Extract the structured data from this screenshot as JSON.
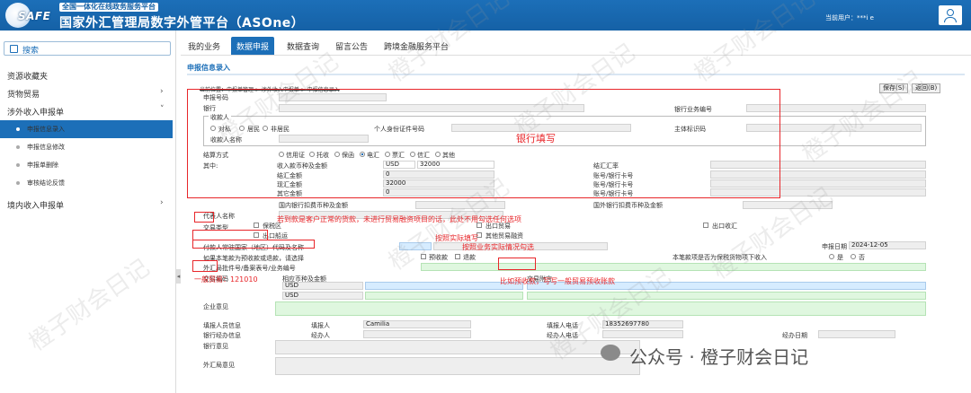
{
  "header": {
    "tagline": "全国一体化在线政务服务平台",
    "title": "国家外汇管理局数字外管平台（ASOne）",
    "logo_text": "SAFE",
    "current_user": "当前用户：***i e"
  },
  "sidebar": {
    "search_label": "搜索",
    "items": [
      {
        "label": "资源收藏夹"
      },
      {
        "label": "货物贸易"
      },
      {
        "label": "涉外收入申报单"
      },
      {
        "label": "境内收入申报单"
      }
    ],
    "sub_items": [
      {
        "label": "申报信息录入"
      },
      {
        "label": "申报信息修改"
      },
      {
        "label": "申报单删除"
      },
      {
        "label": "审核结论反馈"
      }
    ]
  },
  "tabs": [
    {
      "label": "我的业务"
    },
    {
      "label": "数据申报"
    },
    {
      "label": "数据查询"
    },
    {
      "label": "留言公告"
    },
    {
      "label": "跨境金融服务平台"
    }
  ],
  "form": {
    "title": "申报信息录入",
    "breadcrumb": "当前位置：申报单管理 > 涉外收入申报单 > 申报信息录入",
    "save_btn": "保存(S)",
    "back_btn": "返回(B)",
    "labels": {
      "report_no": "申报号码",
      "bank": "银行",
      "bank_business_no": "银行业务编号",
      "payee_group": "收款人",
      "corporate": "对私",
      "resident": "居民",
      "nonresident": "非居民",
      "personal_id": "个人身份证件号码",
      "payee_name": "收款人名称",
      "main_ref": "主体标识码",
      "settle_method": "结算方式",
      "m_credit": "信用证",
      "m_collect": "托收",
      "m_guarantee": "保函",
      "m_tt": "电汇",
      "m_draft": "票汇",
      "m_mail": "信汇",
      "m_other": "其他",
      "among": "其中:",
      "income_ccy_amt": "收入款币种及金额",
      "settle_amt": "结汇金额",
      "fx_amt": "现汇金额",
      "other_amt": "其它金额",
      "settle_rate": "结汇汇率",
      "account_no_1": "账号/银行卡号",
      "account_no_2": "账号/银行卡号",
      "account_no_3": "账号/银行卡号",
      "domestic_fee": "国内银行扣费币种及金额",
      "foreign_fee": "国外银行扣费币种及金额",
      "agent_name": "代表人名称",
      "trade_type": "交易类型",
      "type_bonded": "保税区",
      "type_export": "出口贸易",
      "type_fdi": "出口收汇",
      "type_ship": "出口船运",
      "type_other_trade": "其他贸易融资",
      "payer_country": "付款人常驻国家（地区）代码及名称",
      "report_date": "申报日期",
      "prepaid_q": "如果本笔款为预收款或退款，请选择",
      "prepaid": "预收款",
      "refund": "退款",
      "goods_q": "本笔款项是否为保税货物项下收入",
      "yes": "是",
      "no": "否",
      "fx_bureau_no": "外汇局批件号/备案表号/业务编号",
      "trade_code": "交易编码",
      "corresponding_ccy": "相应币种及金额",
      "trade_note": "交易附言",
      "enterprise_opinion": "企业意见",
      "filler_info": "填报人员信息",
      "filler": "填报人",
      "filler_phone": "填报人电话",
      "bank_staff_info": "银行经办信息",
      "bank_handler": "经办人",
      "handler_phone": "经办人电话",
      "handle_date": "经办日期",
      "bank_opinion": "银行意见",
      "bureau_opinion": "外汇局意见"
    },
    "values": {
      "report_no": "",
      "bank": "",
      "bank_business_no": "",
      "payee_name": "",
      "main_ref": "",
      "income_ccy": "USD",
      "income_amt": "32000",
      "settle_amt": "0",
      "fx_amt": "32000",
      "other_amt": "0",
      "report_date": "2024-12-05",
      "ccy_1": "USD",
      "ccy_2": "USD",
      "trade_code_value": "121010",
      "filler_name": "Camilia",
      "filler_phone": "18352697780"
    }
  },
  "annotations": {
    "bank_fill": "银行填写",
    "fob_note": "若到款是客户正常的货款，未进行贸易融资项目的话，此处不用勾选任何选项",
    "fill_actual": "按照实际填写",
    "select_actual": "按照业务实际情况勾选",
    "general_trade": "一般贸易：121010",
    "prepaid_note": "比如预收款，写写一般贸易预收账款"
  },
  "watermark": {
    "text": "橙子财会日记",
    "footer": "公众号 · 橙子财会日记"
  },
  "colors": {
    "brand": "#1c6fb8",
    "annotation": "#e8262a",
    "field_green": "#dff7df",
    "field_blue": "#d6ecff"
  }
}
